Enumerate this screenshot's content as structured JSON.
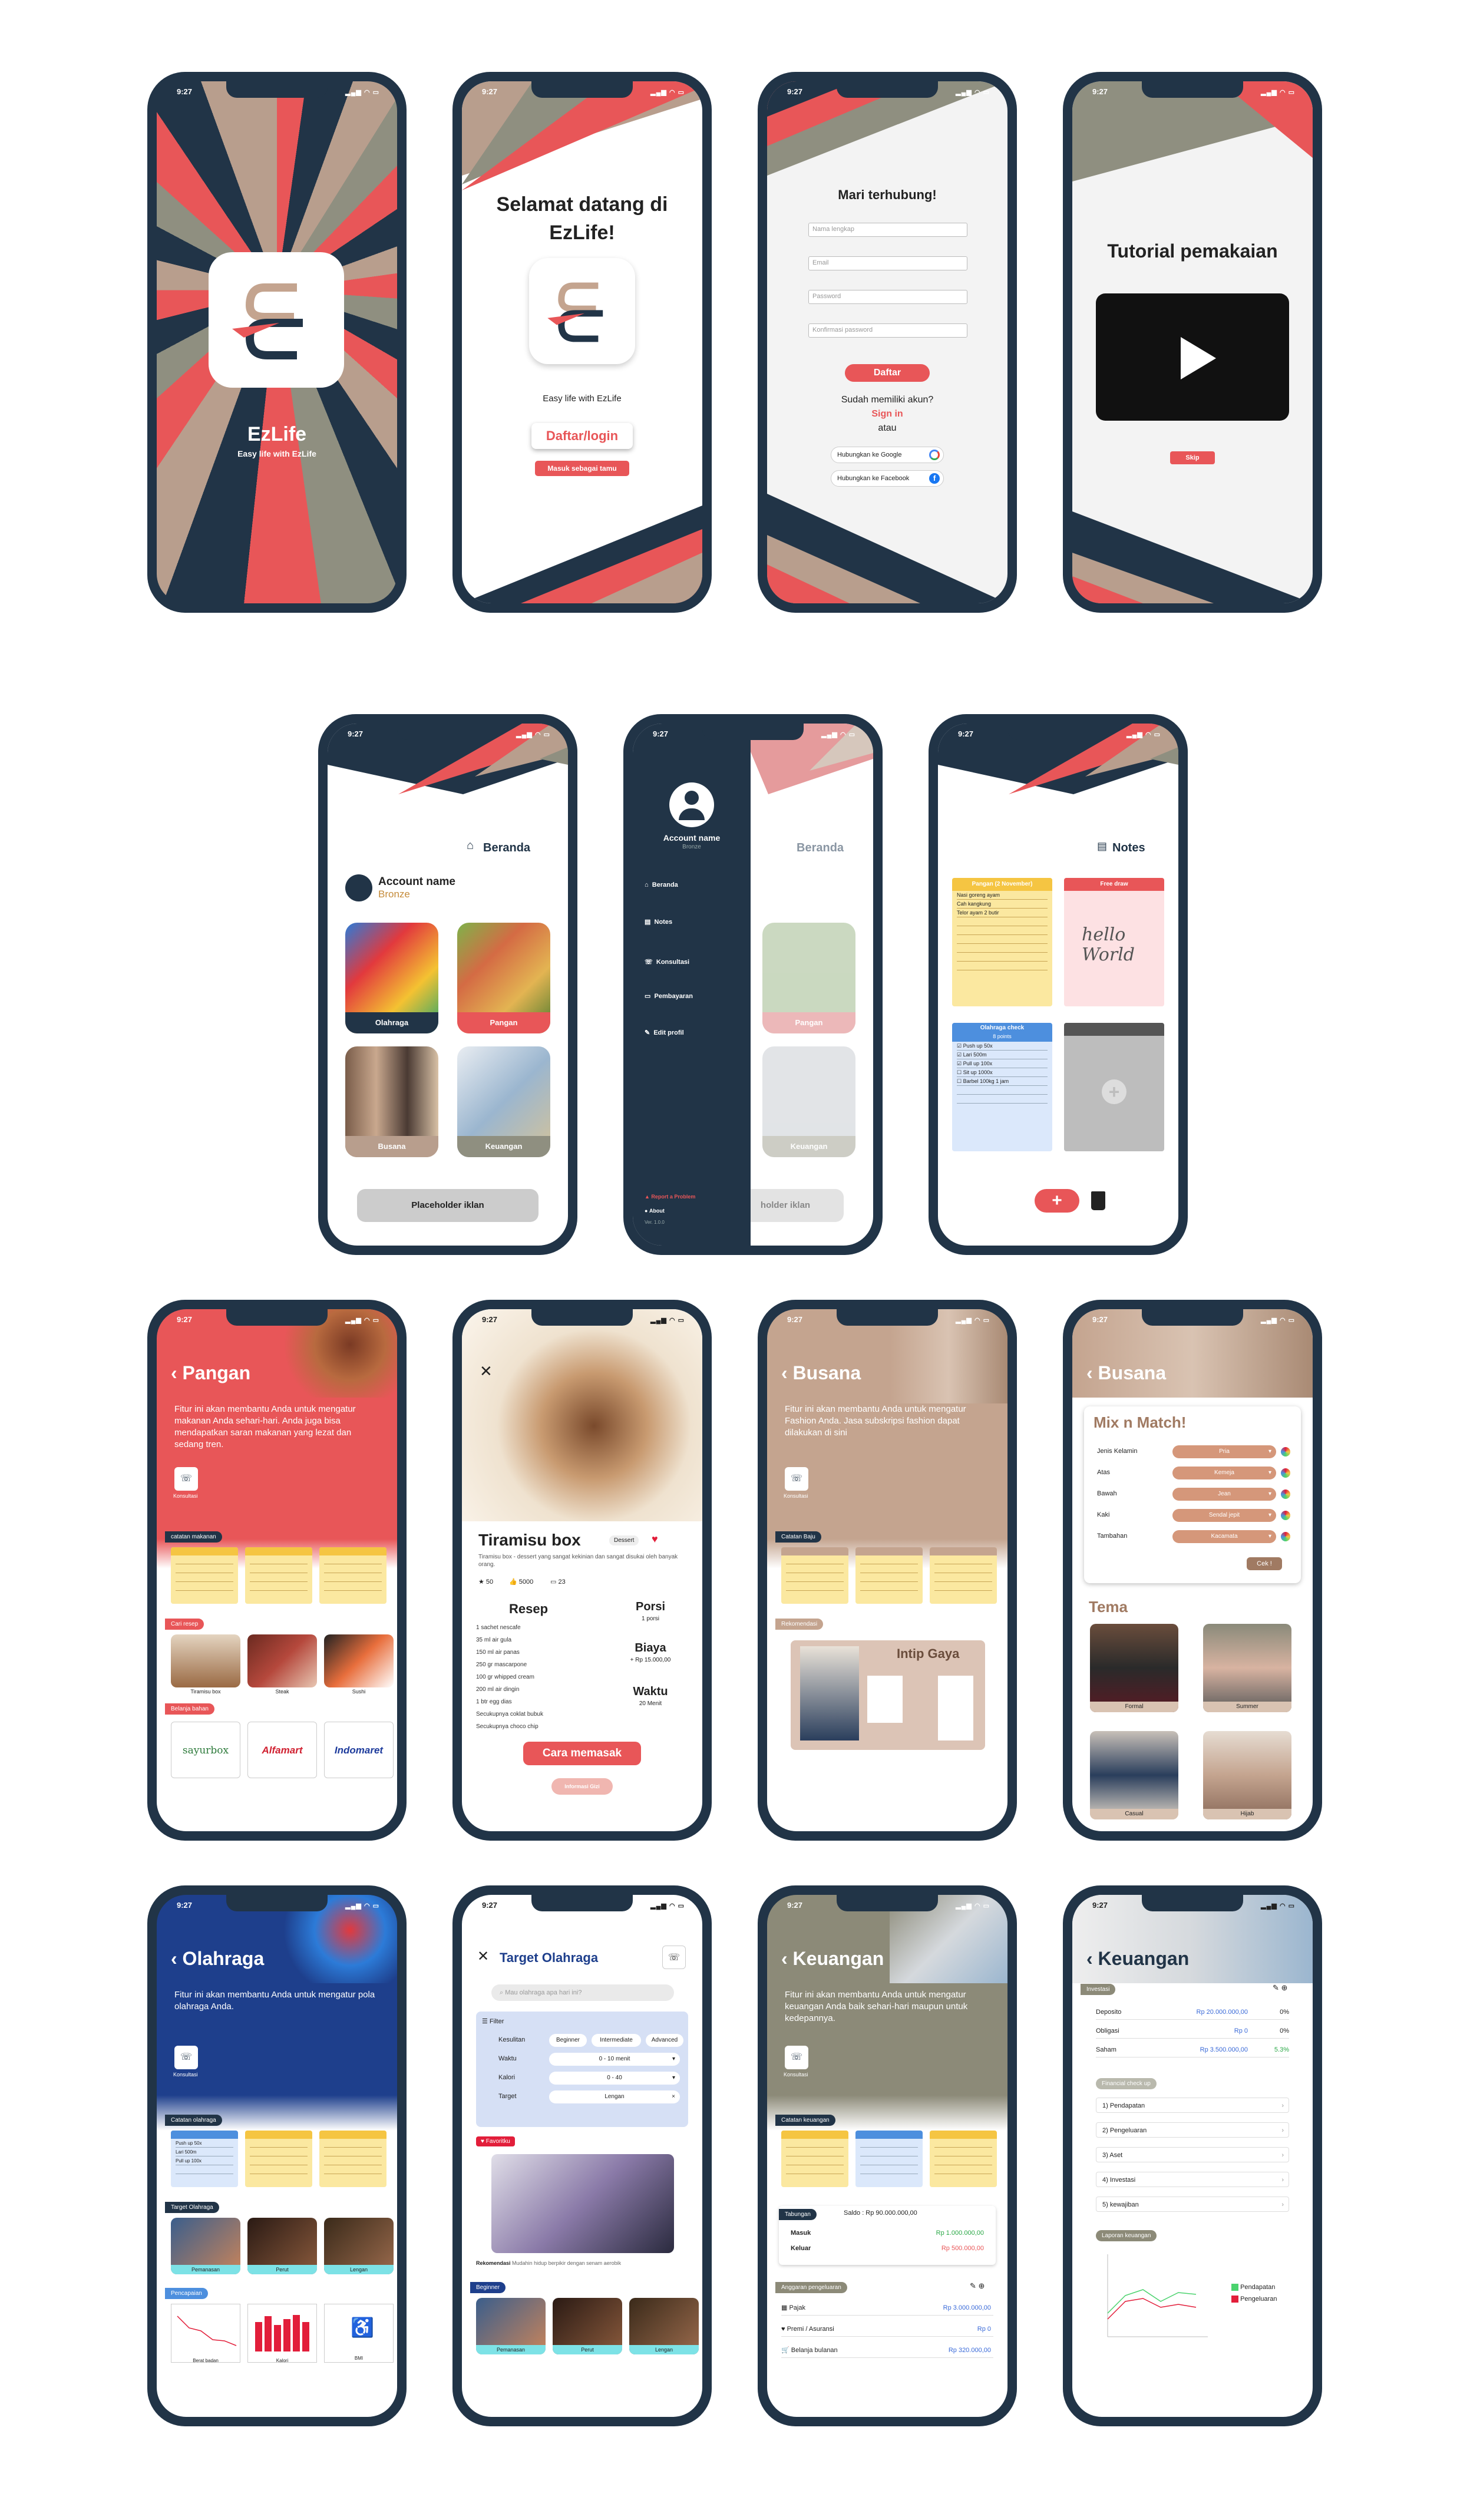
{
  "status_time": "9:27",
  "status_icons": "▂▄▆ ◠ ▭",
  "splash": {
    "app_name": "EzLife",
    "tagline": "Easy life with EzLife"
  },
  "welcome": {
    "title": "Selamat datang di EzLife!",
    "subtitle": "Easy life with EzLife",
    "login_btn": "Daftar/login",
    "guest_btn": "Masuk sebagai tamu"
  },
  "register": {
    "title": "Mari terhubung!",
    "name_ph": "Nama lengkap",
    "email_ph": "Email",
    "pass_ph": "Password",
    "confirm_ph": "Konfirmasi password",
    "submit": "Daftar",
    "have_account": "Sudah memiliki akun?",
    "signin": "Sign in",
    "or": "atau",
    "google": "Hubungkan ke Google",
    "facebook": "Hubungkan ke Facebook"
  },
  "tutorial": {
    "title": "Tutorial pemakaian",
    "skip": "Skip"
  },
  "home": {
    "title": "Beranda",
    "account_name": "Account name",
    "tier": "Bronze",
    "tiles": [
      "Olahraga",
      "Pangan",
      "Busana",
      "Keuangan"
    ],
    "ad": "Placeholder iklan"
  },
  "drawer": {
    "account_name": "Account name",
    "tier": "Bronze",
    "items": [
      "Beranda",
      "Notes",
      "Konsultasi",
      "Pembayaran",
      "Edit profil"
    ],
    "report": "Report a Problem",
    "about": "About",
    "version": "Ver. 1.0.0",
    "ad_partial": "holder iklan"
  },
  "notes": {
    "title": "Notes",
    "n1_head": "Pangan (2 November)",
    "n1_lines": [
      "Nasi goreng ayam",
      "Cah kangkung",
      "Telor ayam 2 butir"
    ],
    "n2_head": "Free draw",
    "n2_text": "hello World",
    "n3_head": "Olahraga check",
    "n3_sub": "8 points",
    "n3_items": [
      "Push up 50x",
      "Lari 500m",
      "Pull up 100x",
      "Sit up 1000x",
      "Barbel 100kg 1 jam"
    ]
  },
  "pangan": {
    "title": "Pangan",
    "desc": "Fitur ini akan membantu Anda untuk mengatur makanan Anda sehari-hari. Anda juga bisa mendapatkan saran makanan yang lezat dan sedang tren.",
    "consult": "Konsultasi",
    "notes_label": "catatan makanan",
    "recipe_label": "Cari resep",
    "shop_label": "Belanja bahan",
    "foods": [
      "Tiramisu box",
      "Steak",
      "Sushi"
    ],
    "shops": [
      "sayurbox",
      "Alfamart",
      "Indomaret"
    ]
  },
  "recipe": {
    "name": "Tiramisu box",
    "tag": "Dessert",
    "desc": "Tiramisu box - dessert yang sangat kekinian dan sangat disukai oleh banyak orang.",
    "stats": [
      "50",
      "5000",
      "23"
    ],
    "resep_label": "Resep",
    "ingredients": [
      "1 sachet nescafe",
      "35 ml air gula",
      "150 ml air panas",
      "250 gr mascarpone",
      "100 gr whipped cream",
      "200 ml air dingin",
      "1 btr egg dias",
      "Secukupnya coklat bubuk",
      "Secukupnya choco chip"
    ],
    "porsi_label": "Porsi",
    "porsi_val": "1 porsi",
    "biaya_label": "Biaya",
    "biaya_val": "+ Rp 15.000,00",
    "waktu_label": "Waktu",
    "waktu_val": "20 Menit",
    "cook_btn": "Cara memasak",
    "info_btn": "Informasi Gizi"
  },
  "busana": {
    "title": "Busana",
    "desc": "Fitur ini akan membantu Anda untuk mengatur Fashion Anda. Jasa subskripsi fashion dapat dilakukan di sini",
    "consult": "Konsultasi",
    "notes_label": "Catatan Baju",
    "rec_label": "Rekomendasi",
    "rec_title": "Intip Gaya"
  },
  "mix": {
    "title": "Busana",
    "heading": "Mix n Match!",
    "rows": [
      [
        "Jenis Kelamin",
        "Pria"
      ],
      [
        "Atas",
        "Kemeja"
      ],
      [
        "Bawah",
        "Jean"
      ],
      [
        "Kaki",
        "Sendal jepit"
      ],
      [
        "Tambahan",
        "Kacamata"
      ]
    ],
    "cek": "Cek !",
    "tema": "Tema",
    "themes": [
      "Formal",
      "Summer",
      "Casual",
      "Hijab"
    ]
  },
  "olahraga": {
    "title": "Olahraga",
    "desc": "Fitur ini akan membantu Anda untuk mengatur pola olahraga Anda.",
    "consult": "Konsultasi",
    "notes_label": "Catatan olahraga",
    "notes_items": [
      "Push up 50x",
      "Lari 500m",
      "Pull up 100x"
    ],
    "target_label": "Target Olahraga",
    "targets": [
      "Pemanasan",
      "Perut",
      "Lengan"
    ],
    "track_label": "Pencapaian",
    "charts": [
      "Berat badan",
      "Kalori",
      "BMI"
    ]
  },
  "target": {
    "title": "Target Olahraga",
    "search_ph": "Mau olahraga apa hari ini?",
    "filter": "Filter",
    "kesulitan": "Kesulitan",
    "levels": [
      "Beginner",
      "Intermediate",
      "Advanced"
    ],
    "waktu": "Waktu",
    "waktu_val": "0 - 10 menit",
    "kalori": "Kalori",
    "kalori_val": "0 - 40",
    "target_lbl": "Target",
    "target_val": "Lengan",
    "favorit": "Favoritku",
    "fav_caption": "Rekomendasi",
    "fav_desc": "Mudahin hidup berpikir dengan senam aerobik",
    "beginner": "Beginner",
    "thumbs": [
      "Pemanasan",
      "Perut",
      "Lengan"
    ]
  },
  "keuangan": {
    "title": "Keuangan",
    "desc": "Fitur ini akan membantu Anda untuk mengatur keuangan Anda baik sehari-hari maupun untuk kedepannya.",
    "consult": "Konsultasi",
    "notes_label": "Catatan keuangan",
    "tab": "Tabungan",
    "saldo": "Saldo : Rp 90.000.000,00",
    "masuk": "Masuk",
    "masuk_val": "Rp 1.000.000,00",
    "keluar": "Keluar",
    "keluar_val": "Rp 500.000,00",
    "budget_label": "Anggaran pengeluaran",
    "budget": [
      [
        "Pajak",
        "Rp 3.000.000,00"
      ],
      [
        "Premi / Asuransi",
        "Rp 0"
      ],
      [
        "Belanja bulanan",
        "Rp 320.000,00"
      ]
    ]
  },
  "keuangan2": {
    "title": "Keuangan",
    "invest_label": "Investasi",
    "invest": [
      [
        "Deposito",
        "Rp 20.000.000,00",
        "0%"
      ],
      [
        "Obligasi",
        "Rp 0",
        "0%"
      ],
      [
        "Saham",
        "Rp 3.500.000,00",
        "5.3%"
      ]
    ],
    "check_label": "Financial check up",
    "check": [
      "1) Pendapatan",
      "2) Pengeluaran",
      "3) Aset",
      "4) Investasi",
      "5) kewajiban"
    ],
    "report_label": "Laporan keuangan",
    "legend": [
      "Pendapatan",
      "Pengeluaran"
    ]
  },
  "colors": {
    "navy": "#213447",
    "red": "#e85658",
    "tan": "#c4a48f",
    "beige": "#b89e8d",
    "gray": "#8f8f80",
    "olive": "#8c8a78",
    "blue": "#1e3f8c"
  }
}
